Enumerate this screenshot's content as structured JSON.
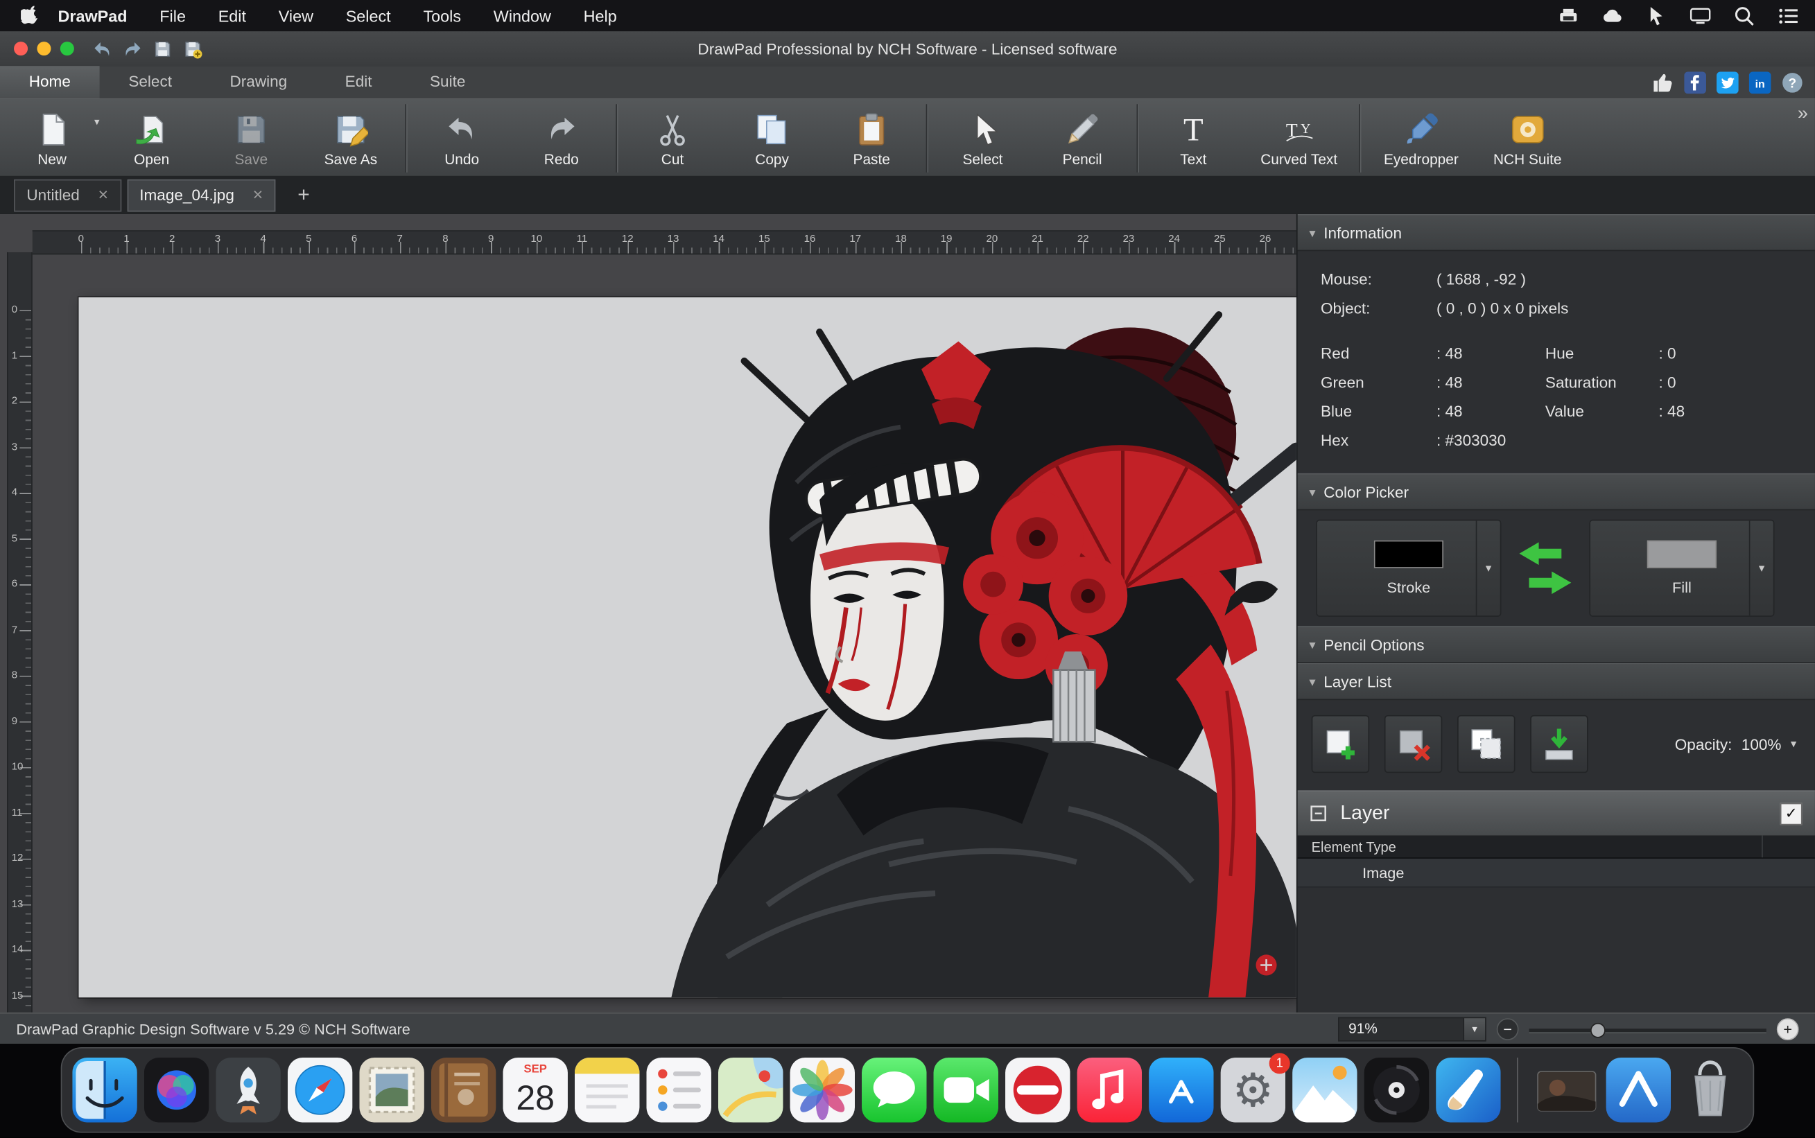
{
  "menu_bar": {
    "app_name": "DrawPad",
    "items": [
      "File",
      "Edit",
      "View",
      "Select",
      "Tools",
      "Window",
      "Help"
    ],
    "status_icons": [
      "scanner",
      "cloud",
      "pointer",
      "display",
      "spotlight",
      "menu-list"
    ]
  },
  "title_bar": {
    "title": "DrawPad Professional by NCH Software - Licensed software",
    "quick_icons": [
      "undo-arrow",
      "redo-arrow",
      "save-disk",
      "save-disk-new"
    ]
  },
  "ribbon": {
    "tabs": [
      "Home",
      "Select",
      "Drawing",
      "Edit",
      "Suite"
    ],
    "active_tab": "Home",
    "social_icons": [
      "thumbs-up",
      "facebook",
      "twitter",
      "linkedin",
      "help"
    ]
  },
  "toolbar": {
    "overflow_glyph": "»",
    "groups": [
      [
        {
          "label": "New",
          "icon": "new-file",
          "dropdown": true
        },
        {
          "label": "Open",
          "icon": "open-folder"
        },
        {
          "label": "Save",
          "icon": "save-disk",
          "disabled": true
        },
        {
          "label": "Save As",
          "icon": "save-as"
        }
      ],
      [
        {
          "label": "Undo",
          "icon": "undo"
        },
        {
          "label": "Redo",
          "icon": "redo"
        }
      ],
      [
        {
          "label": "Cut",
          "icon": "cut"
        },
        {
          "label": "Copy",
          "icon": "copy"
        },
        {
          "label": "Paste",
          "icon": "paste"
        }
      ],
      [
        {
          "label": "Select",
          "icon": "select-cursor"
        },
        {
          "label": "Pencil",
          "icon": "pencil"
        }
      ],
      [
        {
          "label": "Text",
          "icon": "text"
        },
        {
          "label": "Curved Text",
          "icon": "curved-text"
        }
      ],
      [
        {
          "label": "Eyedropper",
          "icon": "eyedropper"
        },
        {
          "label": "NCH Suite",
          "icon": "nch-suite"
        }
      ]
    ]
  },
  "doc_tabs": {
    "tabs": [
      "Untitled",
      "Image_04.jpg"
    ],
    "active_index": 1,
    "close_glyph": "×",
    "add_label": "+"
  },
  "rulers": {
    "horizontal": [
      "0",
      "1",
      "2",
      "3",
      "4",
      "5",
      "6",
      "7",
      "8",
      "9",
      "10",
      "11",
      "12",
      "13",
      "14",
      "15",
      "16",
      "17",
      "18",
      "19",
      "20",
      "21",
      "22",
      "23",
      "24",
      "25",
      "26"
    ],
    "vertical": [
      "0",
      "1",
      "2",
      "3",
      "4",
      "5",
      "6",
      "7",
      "8",
      "9",
      "10",
      "11",
      "12",
      "13",
      "14",
      "15"
    ]
  },
  "panels": {
    "information": {
      "title": "Information",
      "pairs": [
        {
          "label": "Mouse:",
          "value": "( 1688 , -92 )"
        },
        {
          "label": "Object:",
          "value": "( 0 , 0 ) 0 x 0 pixels"
        }
      ],
      "rows": [
        {
          "l1": "Red",
          "v1": ": 48",
          "l2": "Hue",
          "v2": ": 0"
        },
        {
          "l1": "Green",
          "v1": ": 48",
          "l2": "Saturation",
          "v2": ": 0"
        },
        {
          "l1": "Blue",
          "v1": ": 48",
          "l2": "Value",
          "v2": ": 48"
        },
        {
          "l1": "Hex",
          "v1": ": #303030",
          "l2": "",
          "v2": ""
        }
      ]
    },
    "color_picker": {
      "title": "Color Picker",
      "stroke_label": "Stroke",
      "fill_label": "Fill",
      "stroke_color": "#000000",
      "fill_color": "#9a9b9d"
    },
    "pencil_options": {
      "title": "Pencil Options"
    },
    "layer_list": {
      "title": "Layer List",
      "buttons": [
        "add-layer",
        "delete-layer",
        "duplicate-layer",
        "merge-layer"
      ],
      "opacity_label": "Opacity:",
      "opacity_value": "100%",
      "layer_name": "Layer",
      "layer_visible": true,
      "element_type_header": "Element Type",
      "element_type_value": "Image"
    }
  },
  "status_bar": {
    "left_text": "DrawPad Graphic Design Software v 5.29 © NCH Software",
    "zoom_value": "91%"
  },
  "dock": {
    "items": [
      {
        "name": "finder"
      },
      {
        "name": "siri"
      },
      {
        "name": "launchpad"
      },
      {
        "name": "safari"
      },
      {
        "name": "mail"
      },
      {
        "name": "contacts"
      },
      {
        "name": "calendar",
        "month": "SEP",
        "day": "28"
      },
      {
        "name": "notes"
      },
      {
        "name": "reminders"
      },
      {
        "name": "maps"
      },
      {
        "name": "photos"
      },
      {
        "name": "messages"
      },
      {
        "name": "facetime"
      },
      {
        "name": "news"
      },
      {
        "name": "music"
      },
      {
        "name": "app-store"
      },
      {
        "name": "system-preferences",
        "badge": "1"
      },
      {
        "name": "photopad"
      },
      {
        "name": "videopad"
      },
      {
        "name": "drawpad",
        "active": true
      },
      {
        "separator": true
      },
      {
        "name": "minimized-window"
      },
      {
        "name": "nch-app"
      },
      {
        "name": "trash"
      }
    ]
  }
}
